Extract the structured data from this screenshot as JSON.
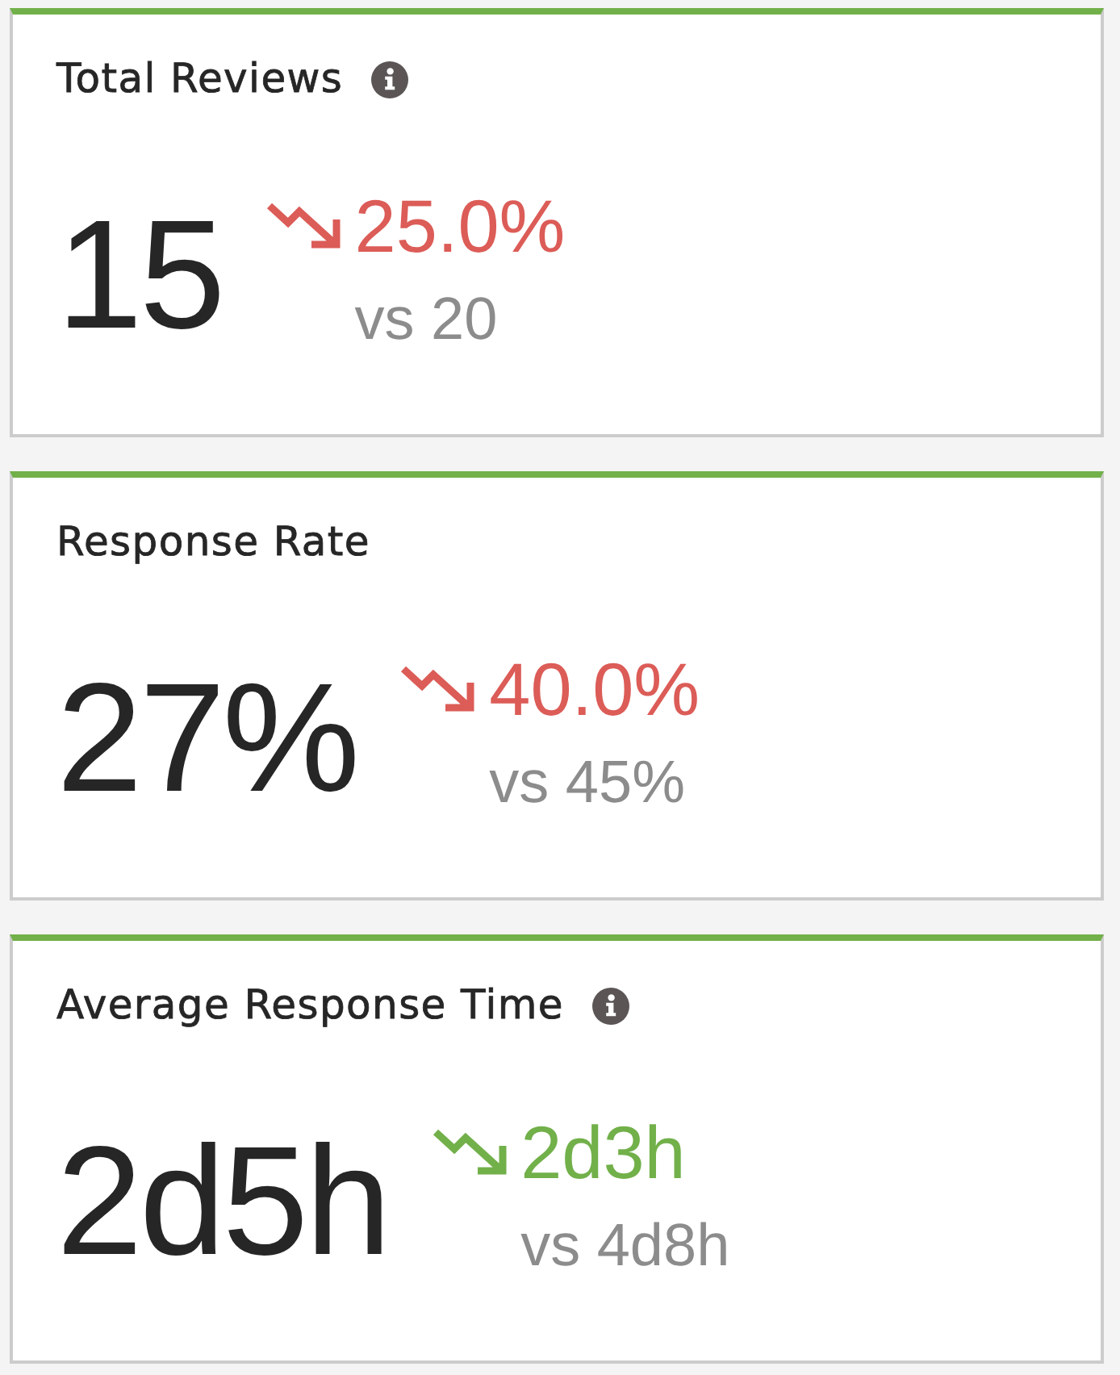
{
  "cards": [
    {
      "title": "Total Reviews",
      "info": true,
      "value": "15",
      "change": {
        "down": true,
        "good": false,
        "text": "25.0%",
        "comparison": "vs 20"
      }
    },
    {
      "title": "Response Rate",
      "info": false,
      "value": "27%",
      "change": {
        "down": true,
        "good": false,
        "text": "40.0%",
        "comparison": "vs 45%"
      }
    },
    {
      "title": "Average Response Time",
      "info": true,
      "value": "2d5h",
      "change": {
        "down": true,
        "good": true,
        "text": "2d3h",
        "comparison": "vs 4d8h"
      }
    }
  ]
}
